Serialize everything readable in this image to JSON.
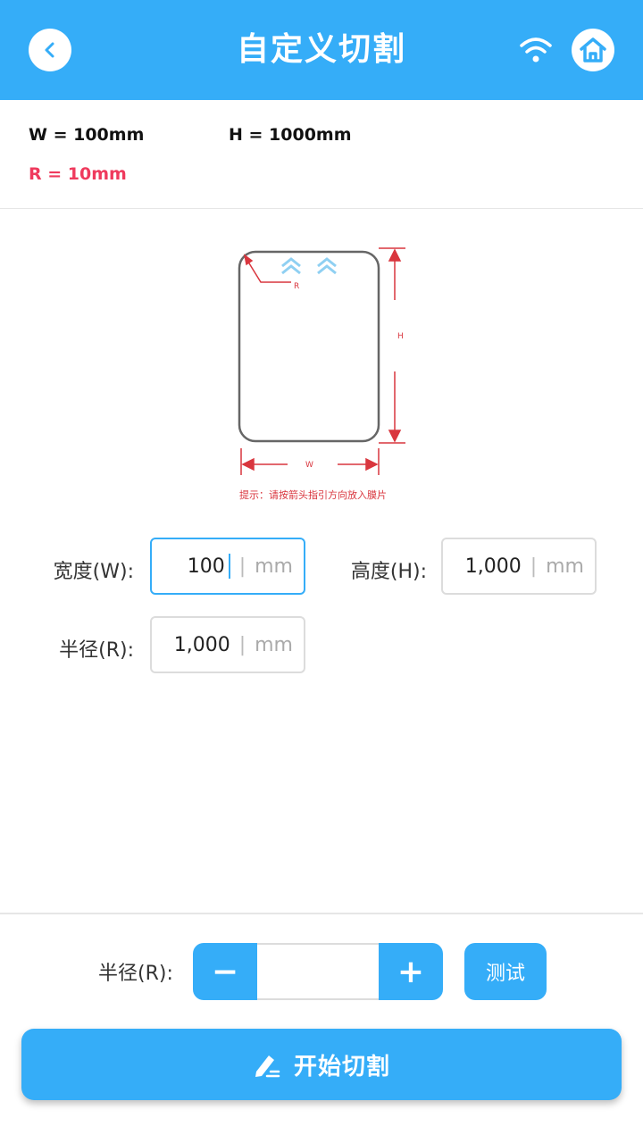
{
  "header": {
    "title": "自定义切割",
    "back_icon": "chevron-left-icon",
    "wifi_icon": "wifi-icon",
    "home_icon": "home-icon"
  },
  "summary": {
    "width_text": "W = 100mm",
    "height_text": "H = 1000mm",
    "radius_text": "R = 10mm"
  },
  "diagram": {
    "label_r": "R",
    "label_h": "H",
    "label_w": "W",
    "hint": "提示：请按箭头指引方向放入膜片"
  },
  "fields": {
    "width": {
      "label": "宽度(W):",
      "value": "100",
      "unit": "mm"
    },
    "height": {
      "label": "高度(H):",
      "value": "1,000",
      "unit": "mm"
    },
    "radius": {
      "label": "半径(R):",
      "value": "1,000",
      "unit": "mm"
    }
  },
  "stepper": {
    "label": "半径(R):",
    "minus": "−",
    "plus": "+",
    "value": ""
  },
  "buttons": {
    "test": "测试",
    "start": "开始切割"
  },
  "colors": {
    "accent": "#35adf8",
    "radius_text": "#ef3a5d",
    "diagram_red": "#d9363e"
  }
}
